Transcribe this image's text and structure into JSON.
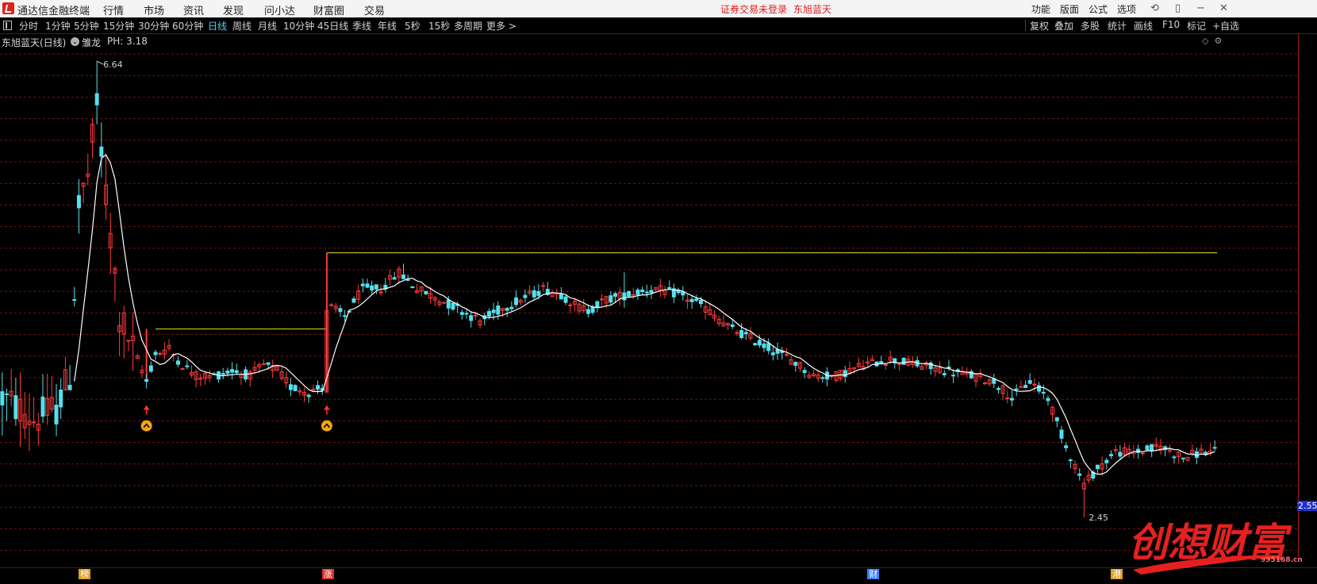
{
  "window": {
    "app_title": "通达信金融终端",
    "menu": [
      "行情",
      "市场",
      "资讯",
      "发现",
      "问小达",
      "财富圈",
      "交易"
    ],
    "notice": [
      "证券交易未登录",
      "东旭蓝天"
    ],
    "right_menu": [
      "功能",
      "版面",
      "公式",
      "选项"
    ]
  },
  "toolbar": {
    "periods": [
      "分时",
      "1分钟",
      "5分钟",
      "15分钟",
      "30分钟",
      "60分钟",
      "日线",
      "周线",
      "月线",
      "10分钟",
      "45日线",
      "季线",
      "年线",
      "5秒",
      "15秒",
      "多周期",
      "更多 >"
    ],
    "active_period": "日线",
    "right_buttons": [
      "复权",
      "叠加",
      "多股",
      "统计",
      "画线",
      "F10",
      "标记",
      "+自选"
    ]
  },
  "info": {
    "stock_title": "东旭蓝天(日线)",
    "indicator_name": "雏龙",
    "ph_label": "PH: 3.18"
  },
  "chart_data": {
    "type": "candlestick",
    "peak_label": "6.64",
    "peak_value": 6.64,
    "low_label": "2.45",
    "low_value": 2.45,
    "current_price_label": "2.55",
    "candle_count": 270,
    "ma_line_color": "#ffffff",
    "up_color": "#ff3b3b",
    "down_color": "#54e0ec",
    "support_lines": [
      {
        "value": 4.18,
        "color": "#e6e61a"
      },
      {
        "value": 4.88,
        "color": "#e6e61a"
      }
    ],
    "signals": [
      {
        "index": 32,
        "type": "buy"
      },
      {
        "index": 72,
        "type": "buy"
      }
    ],
    "events": [
      {
        "label": "榜",
        "index": 18,
        "color": "#e0a020"
      },
      {
        "label": "涨",
        "index": 72,
        "color": "#e03030"
      },
      {
        "label": "财",
        "index": 193,
        "color": "#3a7fff"
      },
      {
        "label": "港",
        "index": 247,
        "color": "#e0a020"
      }
    ],
    "grid_lines": true,
    "grid_color": "#7a1010"
  },
  "watermark": {
    "text": "创想财富",
    "sub": "995168.cn"
  }
}
